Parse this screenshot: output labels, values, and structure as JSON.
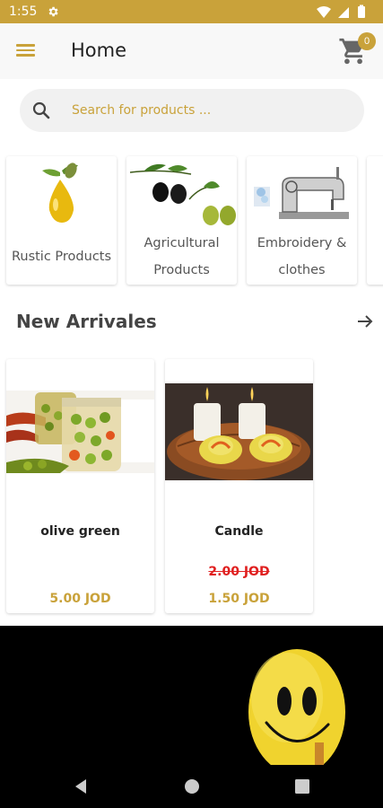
{
  "status_bar": {
    "time": "1:55",
    "icons": [
      "gear-icon",
      "wifi-icon",
      "signal-icon",
      "battery-icon"
    ]
  },
  "app_bar": {
    "title": "Home",
    "menu_icon": "hamburger-menu-icon",
    "cart_icon": "shopping-cart-icon",
    "cart_count": "0"
  },
  "search": {
    "placeholder": "Search for products ..."
  },
  "categories": [
    {
      "line1": "Rustic Products",
      "line2": ""
    },
    {
      "line1": "Agricultural",
      "line2": "Products"
    },
    {
      "line1": "Embroidery &",
      "line2": "clothes"
    }
  ],
  "new_arrivals": {
    "title": "New Arrivales",
    "arrow_icon": "arrow-right-icon"
  },
  "products": [
    {
      "name": "olive green",
      "old_price": "",
      "price": "5.00 JOD"
    },
    {
      "name": "Candle",
      "old_price": "2.00 JOD",
      "price": "1.50 JOD"
    }
  ],
  "nav_bar": {
    "icons": [
      "back-icon",
      "home-icon",
      "recents-icon"
    ]
  },
  "colors": {
    "accent": "#c9a23a",
    "sale_red": "#e02020",
    "title_text": "#444444"
  }
}
